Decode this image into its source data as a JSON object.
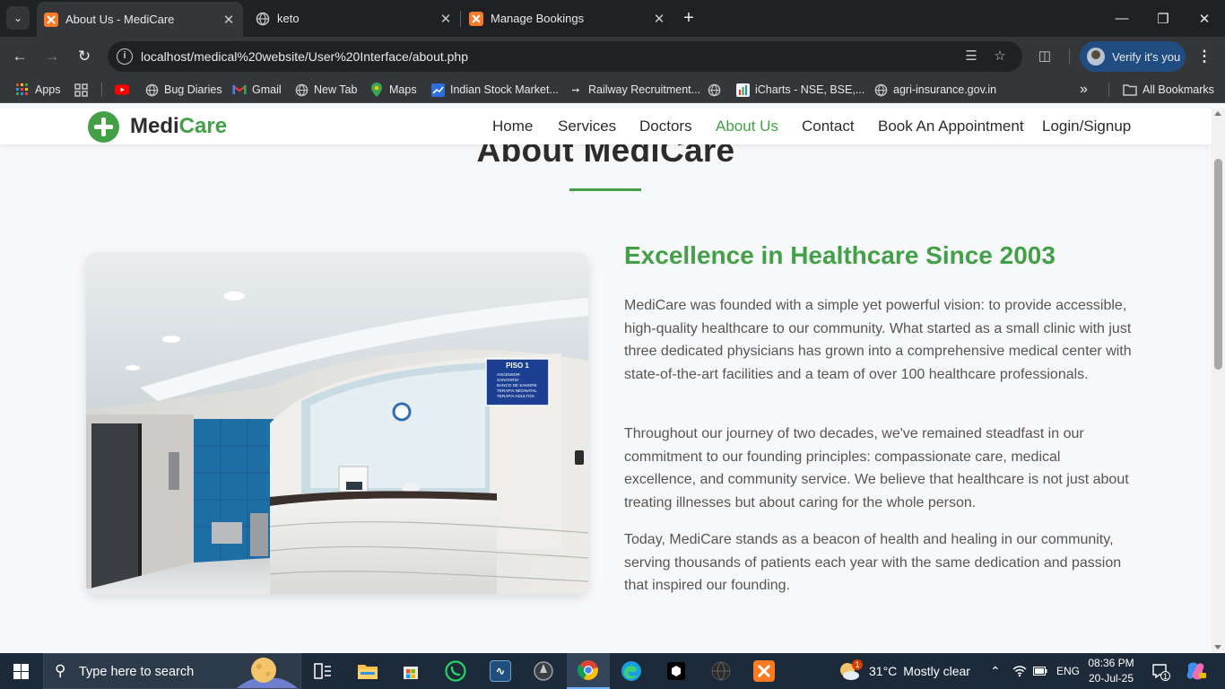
{
  "browser": {
    "tabs": [
      {
        "title": "About Us - MediCare",
        "active": true
      },
      {
        "title": "keto",
        "active": false
      },
      {
        "title": "Manage Bookings",
        "active": false
      }
    ],
    "url": "localhost/medical%20website/User%20Interface/about.php",
    "profile_label": "Verify it's you",
    "bookmarks": [
      {
        "label": "Apps",
        "icon": "apps-grid-icon"
      },
      {
        "label": "Bug Diaries",
        "icon": "globe-icon"
      },
      {
        "label": "Gmail",
        "icon": "gmail-icon"
      },
      {
        "label": "New Tab",
        "icon": "globe-icon"
      },
      {
        "label": "Maps",
        "icon": "maps-pin-icon"
      },
      {
        "label": "Indian Stock Market...",
        "icon": "stock-icon"
      },
      {
        "label": "Railway Recruitment...",
        "icon": "railway-icon"
      },
      {
        "label": "iCharts - NSE, BSE,...",
        "icon": "icharts-icon"
      },
      {
        "label": "agri-insurance.gov.in",
        "icon": "globe-icon"
      }
    ],
    "all_bookmarks_label": "All Bookmarks"
  },
  "site": {
    "logo": {
      "part1": "Medi",
      "part2": "Care"
    },
    "nav": [
      {
        "label": "Home",
        "active": false
      },
      {
        "label": "Services",
        "active": false
      },
      {
        "label": "Doctors",
        "active": false
      },
      {
        "label": "About Us",
        "active": true
      },
      {
        "label": "Contact",
        "active": false
      },
      {
        "label": "Book An Appointment",
        "active": false
      },
      {
        "label": "Login/Signup",
        "active": false
      }
    ],
    "accent_color": "#43a047"
  },
  "about": {
    "title": "About MediCare",
    "image_description_label": "Hospital reception desk",
    "sign_lines": [
      "PISO 1",
      "ASCENSOR",
      "SANITARIO",
      "BANCO DE SANGRE",
      "TERAPIA NEONATAL",
      "TERAPIA ADULTOS"
    ],
    "heading": "Excellence in Healthcare Since 2003",
    "paragraphs": [
      "MediCare was founded with a simple yet powerful vision: to provide accessible, high-quality healthcare to our community. What started as a small clinic with just three dedicated physicians has grown into a comprehensive medical center with state-of-the-art facilities and a team of over 100 healthcare professionals.",
      "Throughout our journey of two decades, we've remained steadfast in our commitment to our founding principles: compassionate care, medical excellence, and community service. We believe that healthcare is not just about treating illnesses but about caring for the whole person.",
      "Today, MediCare stands as a beacon of health and healing in our community, serving thousands of patients each year with the same dedication and passion that inspired our founding."
    ]
  },
  "taskbar": {
    "search_placeholder": "Type here to search",
    "weather_temp": "31°C",
    "weather_text": "Mostly clear",
    "weather_badge": "1",
    "language": "ENG",
    "time": "08:36 PM",
    "date": "20-Jul-25",
    "notification_count": "1"
  }
}
